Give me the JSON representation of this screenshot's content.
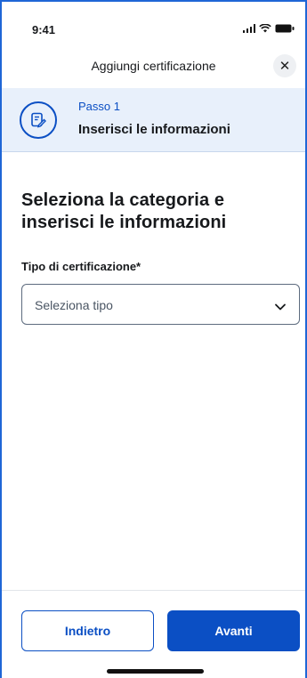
{
  "status_bar": {
    "time": "9:41"
  },
  "header": {
    "title": "Aggiungi certificazione",
    "close_glyph": "✕"
  },
  "step": {
    "number_label": "Passo 1",
    "title": "Inserisci le informazioni",
    "icon": "document-edit-icon"
  },
  "main": {
    "heading": "Seleziona la categoria e inserisci le informazioni",
    "field_label": "Tipo di certificazione*",
    "select_placeholder": "Seleziona tipo"
  },
  "footer": {
    "back_label": "Indietro",
    "next_label": "Avanti"
  },
  "colors": {
    "primary": "#0b4fc4",
    "step_bg": "#e8f0fb",
    "frame_border": "#1f66d6"
  }
}
